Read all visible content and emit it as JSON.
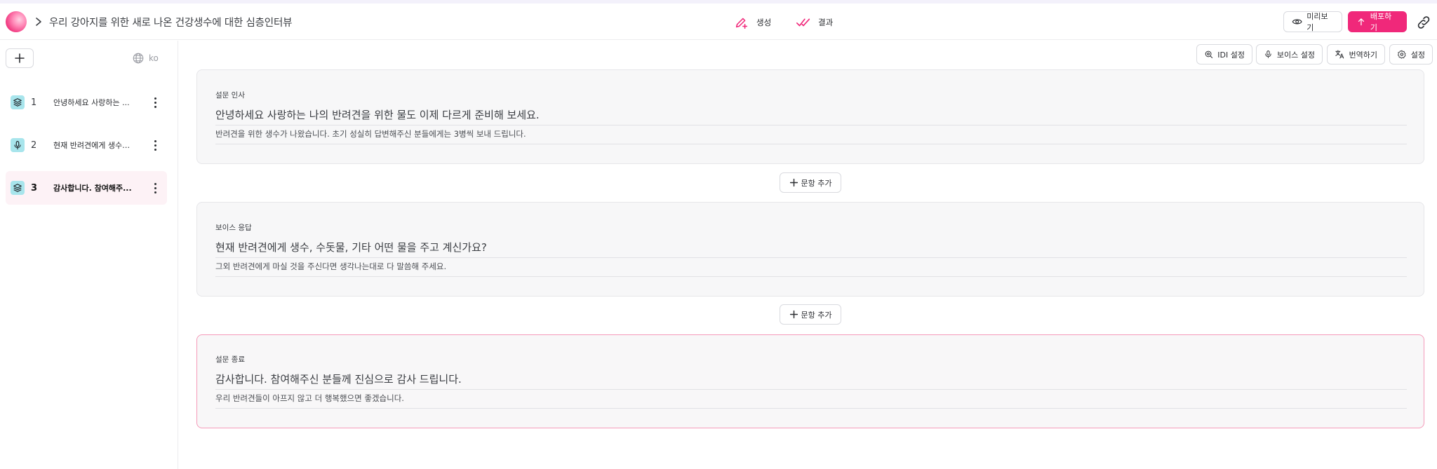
{
  "header": {
    "survey_title": "우리 강아지를 위한 새로 나온 건강생수에 대한 심층인터뷰",
    "tab_create": "생성",
    "tab_result": "결과",
    "preview_label": "미리보기",
    "deploy_label": "배포하기"
  },
  "sidebar": {
    "language": "ko",
    "items": [
      {
        "num": "1",
        "text": "안녕하세요 사랑하는 ...",
        "type": "layers-icon"
      },
      {
        "num": "2",
        "text": "현재 반려견에게 생수,...",
        "type": "mic-icon"
      },
      {
        "num": "3",
        "text": "감사합니다. 참여해주...",
        "type": "layers-icon"
      }
    ]
  },
  "toolbar": {
    "idi_settings": "IDI 설정",
    "voice_settings": "보이스 설정",
    "translate": "번역하기",
    "settings": "설정"
  },
  "cards": [
    {
      "label": "설문 인사",
      "title": "안녕하세요 사랑하는 나의 반려견을 위한 물도 이제 다르게 준비해 보세요.",
      "subtitle": "반려견을 위한 생수가 나왔습니다. 초기 성실히 답변해주신 분들에게는 3병씩 보내 드립니다."
    },
    {
      "label": "보이스 응답",
      "title": "현재 반려견에게 생수, 수돗물, 기타 어떤 물을 주고 계신가요?",
      "subtitle": "그외 반려견에게 마실 것을 주신다면 생각나는대로 다 말씀해 주세요."
    },
    {
      "label": "설문 종료",
      "title": "감사합니다. 참여해주신 분들께 진심으로 감사 드립니다.",
      "subtitle": "우리 반려견들이 아프지 않고 더 행복했으면 좋겠습니다."
    }
  ],
  "add_question_label": "문항 추가",
  "colors": {
    "accent": "#f0287a",
    "active_border": "#f59ab9",
    "active_bg": "#fdf2f6",
    "icon_bg": "#a8e5ec"
  }
}
